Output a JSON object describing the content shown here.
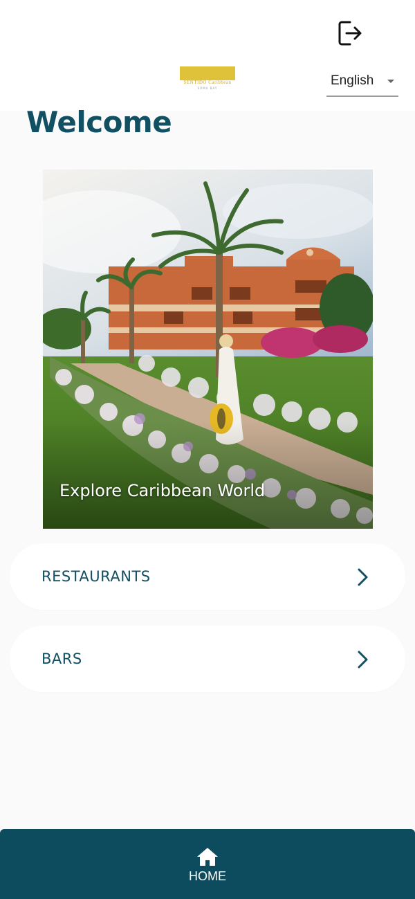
{
  "header": {
    "logout_icon": "logout-icon",
    "logo": {
      "line1": "SENTIDO Caribbean",
      "line2": "SOMA BAY"
    },
    "language": {
      "selected": "English"
    }
  },
  "main": {
    "title": "Welcome",
    "hero": {
      "caption": "Explore Caribbean World"
    },
    "menu": [
      {
        "label": "RESTAURANTS",
        "icon": "chevron-right-icon"
      },
      {
        "label": "BARS",
        "icon": "chevron-right-icon"
      }
    ]
  },
  "bottom_nav": {
    "items": [
      {
        "label": "HOME",
        "icon": "home-icon"
      }
    ]
  },
  "colors": {
    "primary": "#114f62",
    "nav_bg": "#0d4b5e",
    "logo_gold": "#e0c23a",
    "background": "#fafafa"
  }
}
